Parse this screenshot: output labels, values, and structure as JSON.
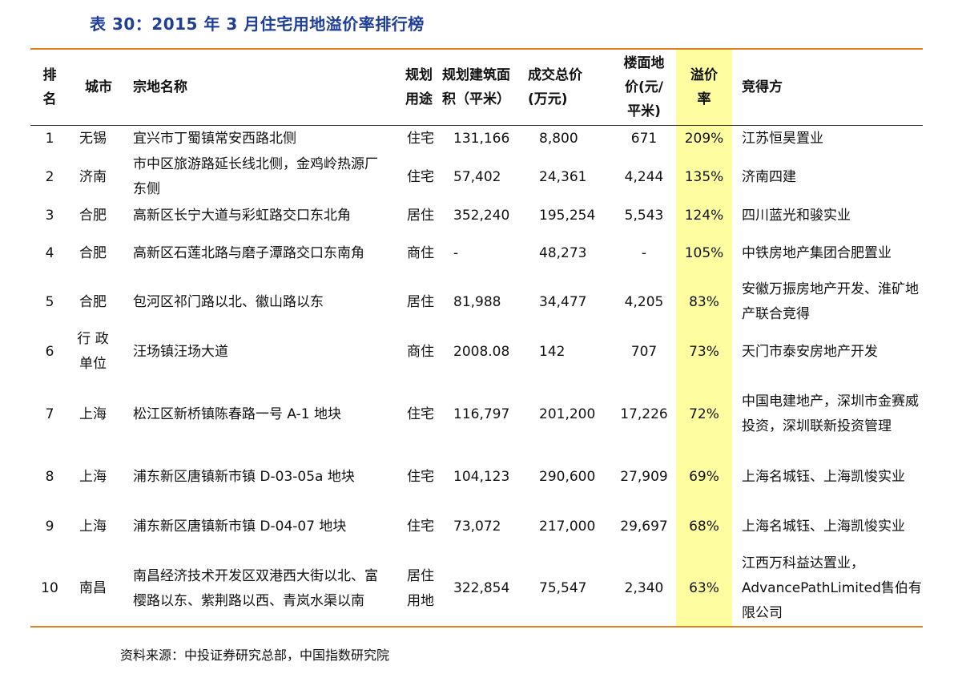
{
  "title": "表 30：2015 年 3 月住宅用地溢价率排行榜",
  "columns": {
    "rank": "排\n名",
    "city": "城市",
    "name": "宗地名称",
    "use": "规划\n用途",
    "area": "规划建筑面\n积（平米）",
    "price": "成交总价\n(万元)",
    "floor": "楼面地\n价(元/\n平米)",
    "premium": "溢价\n率",
    "bidder": "竞得方"
  },
  "rows": [
    {
      "rank": "1",
      "city": "无锡",
      "name": "宜兴市丁蜀镇常安西路北侧",
      "use": "住宅",
      "area": "131,166",
      "price": "8,800",
      "floor": "671",
      "premium": "209%",
      "bidder": "江苏恒昊置业"
    },
    {
      "rank": "2",
      "city": "济南",
      "name": "市中区旅游路延长线北侧，金鸡岭热源厂东侧",
      "use": "住宅",
      "area": "57,402",
      "price": "24,361",
      "floor": "4,244",
      "premium": "135%",
      "bidder": "济南四建"
    },
    {
      "rank": "3",
      "city": "合肥",
      "name": "高新区长宁大道与彩虹路交口东北角",
      "use": "居住",
      "area": "352,240",
      "price": "195,254",
      "floor": "5,543",
      "premium": "124%",
      "bidder": "四川蓝光和骏实业"
    },
    {
      "rank": "4",
      "city": "合肥",
      "name": "高新区石莲北路与磨子潭路交口东南角",
      "use": "商住",
      "area": "-",
      "price": "48,273",
      "floor": "-",
      "premium": "105%",
      "bidder": "中铁房地产集团合肥置业"
    },
    {
      "rank": "5",
      "city": "合肥",
      "name": "包河区祁门路以北、徽山路以东",
      "use": "居住",
      "area": "81,988",
      "price": "34,477",
      "floor": "4,205",
      "premium": "83%",
      "bidder": "安徽万振房地产开发、淮矿地产联合竞得"
    },
    {
      "rank": "6",
      "city": "行 政\n单位",
      "name": "汪场镇汪场大道",
      "use": "商住",
      "area": "2008.08",
      "price": "142",
      "floor": "707",
      "premium": "73%",
      "bidder": "天门市泰安房地产开发"
    },
    {
      "rank": "7",
      "city": "上海",
      "name": "松江区新桥镇陈春路一号 A-1 地块",
      "use": "住宅",
      "area": "116,797",
      "price": "201,200",
      "floor": "17,226",
      "premium": "72%",
      "bidder": "中国电建地产，深圳市金赛威投资，深圳联新投资管理"
    },
    {
      "rank": "8",
      "city": "上海",
      "name": "浦东新区唐镇新市镇 D-03-05a 地块",
      "use": "住宅",
      "area": "104,123",
      "price": "290,600",
      "floor": "27,909",
      "premium": "69%",
      "bidder": "上海名城钰、上海凯悛实业"
    },
    {
      "rank": "9",
      "city": "上海",
      "name": "浦东新区唐镇新市镇 D-04-07 地块",
      "use": "住宅",
      "area": "73,072",
      "price": "217,000",
      "floor": "29,697",
      "premium": "68%",
      "bidder": "上海名城钰、上海凯悛实业"
    },
    {
      "rank": "10",
      "city": "南昌",
      "name": "南昌经济技术开发区双港西大街以北、富樱路以东、紫荆路以西、青岚水渠以南",
      "use": "居住\n用地",
      "area": "322,854",
      "price": "75,547",
      "floor": "2,340",
      "premium": "63%",
      "bidder": "江西万科益达置业，AdvancePathLimited售伯有限公司"
    }
  ],
  "source": "资料来源：中投证券研究总部，中国指数研究院",
  "colors": {
    "title": "#1f3f96",
    "rule": "#e67e22",
    "highlight": "#fefda0"
  }
}
